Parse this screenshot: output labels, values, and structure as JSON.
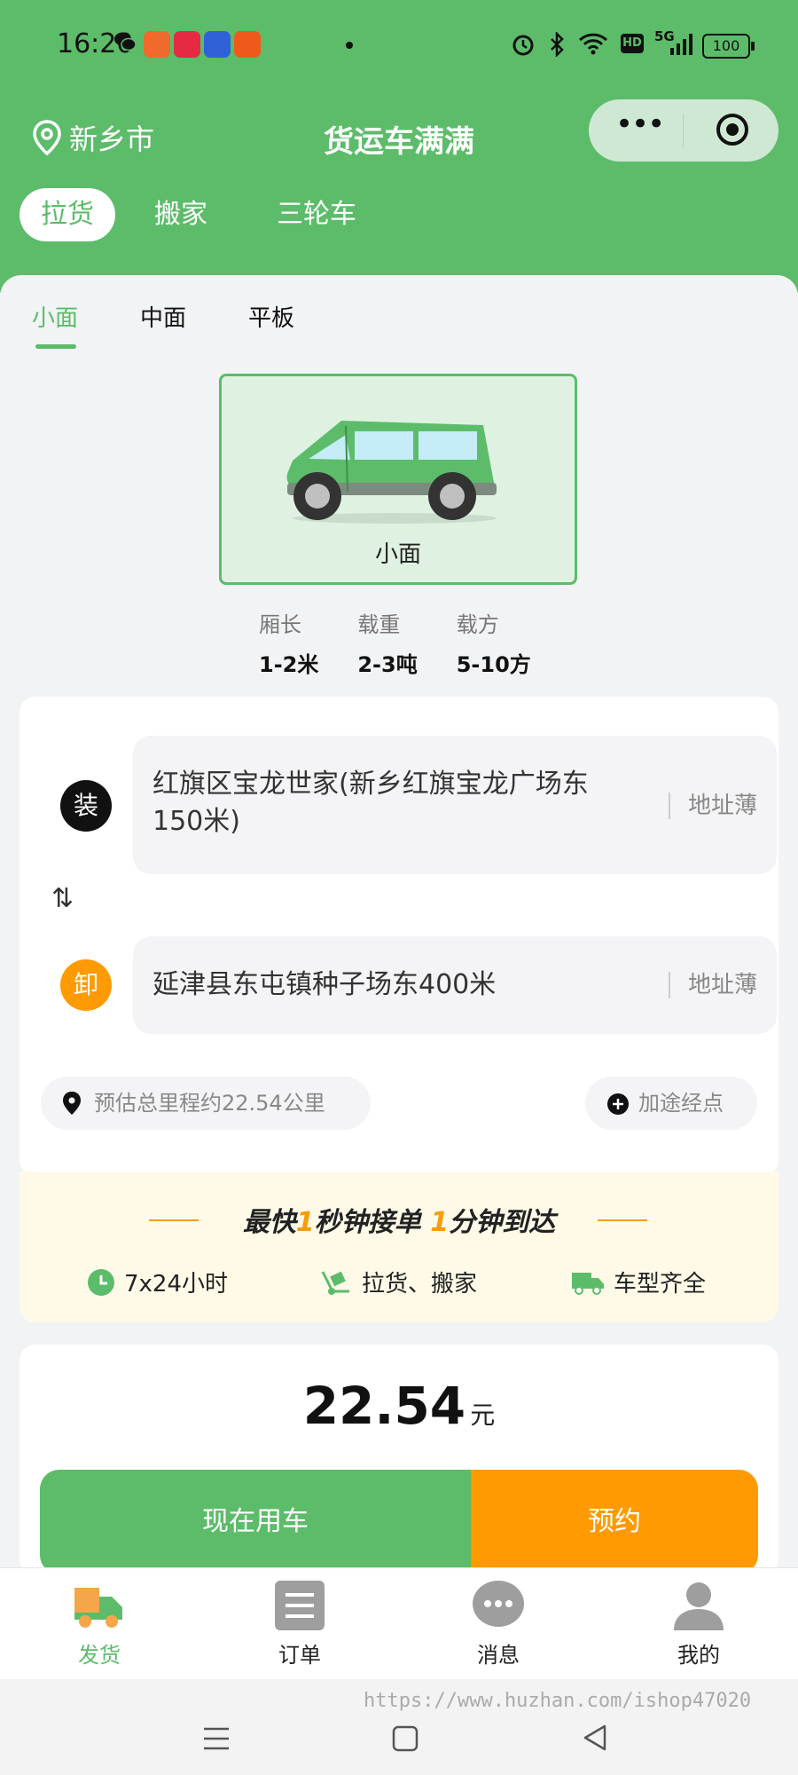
{
  "status_bar": {
    "time": "16:20",
    "battery": "100",
    "network": "5G",
    "hd": "HD"
  },
  "header": {
    "city": "新乡市",
    "title": "货运车满满"
  },
  "main_tabs": [
    "拉货",
    "搬家",
    "三轮车"
  ],
  "sub_tabs": [
    "小面",
    "中面",
    "平板"
  ],
  "vehicle": {
    "name": "小面"
  },
  "specs": [
    {
      "label": "厢长",
      "value": "1-2米"
    },
    {
      "label": "载重",
      "value": "2-3吨"
    },
    {
      "label": "载方",
      "value": "5-10方"
    }
  ],
  "route": {
    "load_badge": "装",
    "load_address": "红旗区宝龙世家(新乡红旗宝龙广场东150米)",
    "unload_badge": "卸",
    "unload_address": "延津县东屯镇种子场东400米",
    "address_book": "地址薄",
    "swap_icon": "⇅",
    "distance": "预估总里程约22.54公里",
    "add_stop": "加途经点"
  },
  "promo": {
    "head_parts": [
      "最快",
      "1",
      "秒钟接单 ",
      "1",
      "分钟到达"
    ],
    "features": [
      "7x24小时",
      "拉货、搬家",
      "车型齐全"
    ]
  },
  "price": {
    "amount": "22.54",
    "unit": "元"
  },
  "actions": {
    "now": "现在用车",
    "reserve": "预约"
  },
  "tab_bar": [
    "发货",
    "订单",
    "消息",
    "我的"
  ],
  "watermark": "https://www.huzhan.com/ishop47020",
  "colors": {
    "green": "#5cbc6a",
    "orange": "#ff9a00",
    "dark": "#111111"
  }
}
